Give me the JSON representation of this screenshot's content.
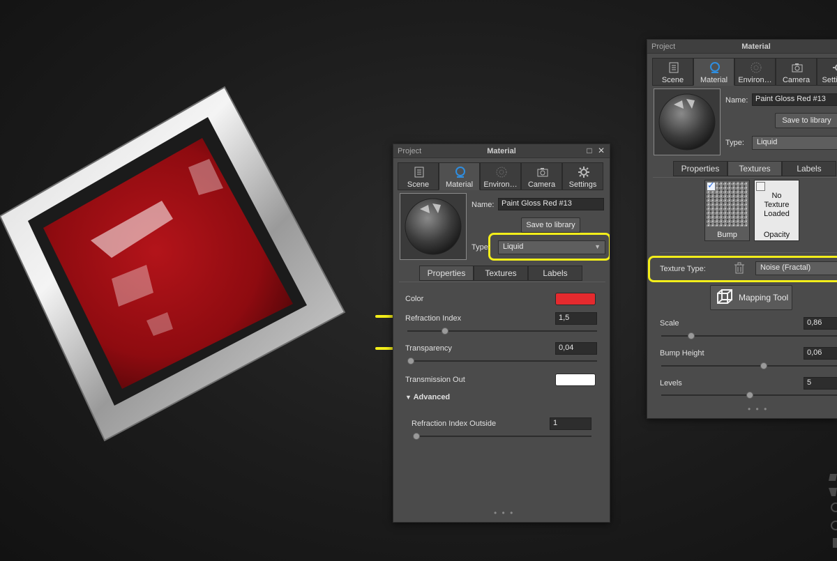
{
  "colors": {
    "highlight": "#f3ee1a",
    "swatch_color": "#e52a2e",
    "swatch_transmission": "#ffffff",
    "accent_icon": "#2f8ee0"
  },
  "panel_center": {
    "header_left": "Project",
    "header_title": "Material",
    "tabs": [
      "Scene",
      "Material",
      "Environ…",
      "Camera",
      "Settings"
    ],
    "name_label": "Name:",
    "name_value": "Paint Gloss Red #13",
    "save_button": "Save to library",
    "type_label": "Type:",
    "type_value": "Liquid",
    "subtabs": [
      "Properties",
      "Textures",
      "Labels"
    ],
    "props": {
      "color_label": "Color",
      "refraction_label": "Refraction Index",
      "refraction_value": "1,5",
      "transparency_label": "Transparency",
      "transparency_value": "0,04",
      "transmission_label": "Transmission Out",
      "advanced_label": "Advanced",
      "refraction_outside_label": "Refraction Index Outside",
      "refraction_outside_value": "1"
    },
    "more": "• • •"
  },
  "panel_right": {
    "header_left": "Project",
    "header_title": "Material",
    "tabs": [
      "Scene",
      "Material",
      "Environ…",
      "Camera",
      "Setti"
    ],
    "name_label": "Name:",
    "name_value": "Paint Gloss Red #13",
    "save_button": "Save to library",
    "type_label": "Type:",
    "type_value": "Liquid",
    "subtabs": [
      "Properties",
      "Textures",
      "Labels"
    ],
    "tex_bump_label": "Bump",
    "tex_opacity_label": "Opacity",
    "tex_empty_line1": "No",
    "tex_empty_line2": "Texture",
    "tex_empty_line3": "Loaded",
    "texture_type_label": "Texture Type:",
    "texture_type_value": "Noise (Fractal)",
    "mapping_tool": "Mapping Tool",
    "scale_label": "Scale",
    "scale_value": "0,86",
    "bump_height_label": "Bump Height",
    "bump_height_value": "0,06",
    "levels_label": "Levels",
    "levels_value": "5",
    "more": "• • •"
  },
  "levels": {
    "refraction_slider": 0.2,
    "transparency_slider": 0.02,
    "refraction_outside_slider": 0.02,
    "scale_slider": 0.17,
    "bump_height_slider": 0.58,
    "levels_slider": 0.5
  }
}
